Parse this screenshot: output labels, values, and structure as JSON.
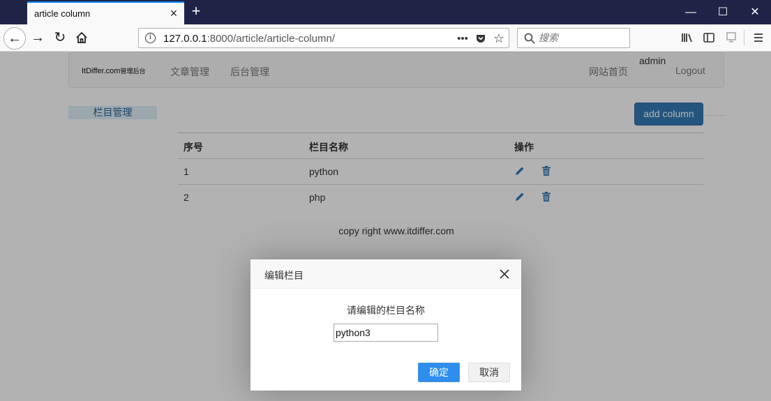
{
  "browser": {
    "tab_title": "article column",
    "url_host": "127.0.0.1",
    "url_rest": ":8000/article/article-column/",
    "search_placeholder": "搜索",
    "page_actions_label": "•••"
  },
  "navbar": {
    "brand": "ItDiffer.com",
    "brand_sub": "管理后台",
    "links": [
      "文章管理",
      "后台管理"
    ],
    "home_link": "网站首页",
    "username": "admin",
    "logout": "Logout"
  },
  "sidebar": {
    "items": [
      {
        "label": "栏目管理"
      }
    ]
  },
  "content": {
    "add_button": "add column",
    "table": {
      "headers": [
        "序号",
        "栏目名称",
        "操作"
      ],
      "rows": [
        {
          "index": "1",
          "name": "python"
        },
        {
          "index": "2",
          "name": "php"
        }
      ]
    },
    "footer": "copy right www.itdiffer.com"
  },
  "dialog": {
    "title": "编辑栏目",
    "label": "请编辑的栏目名称",
    "input_value": "python3",
    "ok": "确定",
    "cancel": "取消"
  },
  "colors": {
    "titlebar": "#1f2447",
    "primary_button": "#337ab7",
    "dialog_ok": "#2e8ded",
    "action_icon": "#337ab7"
  }
}
